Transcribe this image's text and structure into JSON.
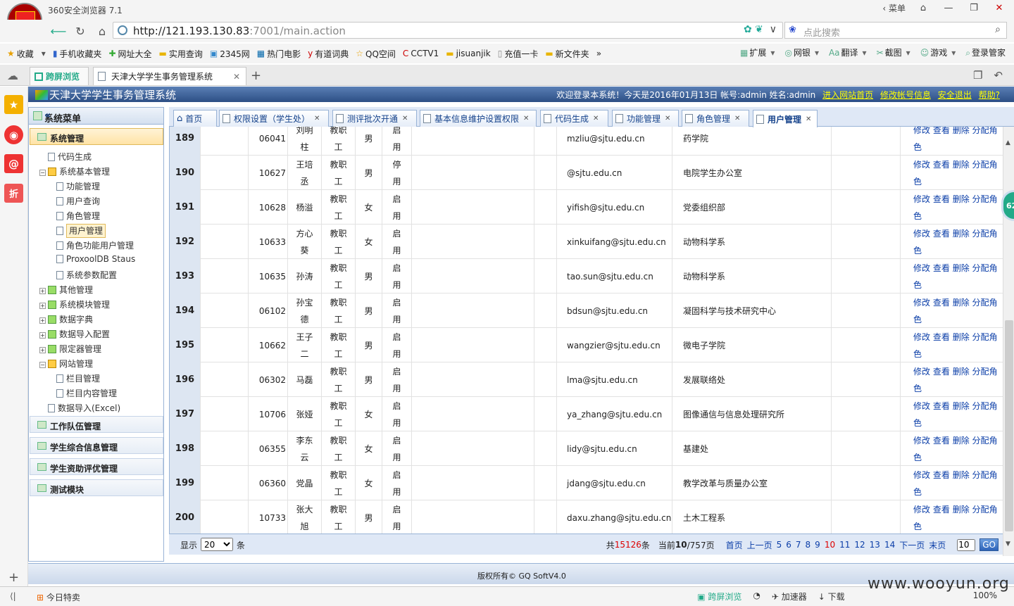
{
  "browser": {
    "title": "360安全浏览器 7.1",
    "menu_label": "菜单",
    "url_host": "http://121.193.130.83",
    "url_rest": ":7001/main.action",
    "search_placeholder": "点此搜索",
    "bookmarks": [
      "收藏",
      "手机收藏夹",
      "网址大全",
      "实用查询",
      "2345网",
      "热门电影",
      "有道词典",
      "QQ空间",
      "CCTV1",
      "jisuanjik",
      "充值一卡",
      "新文件夹",
      "»"
    ],
    "bookmark_tools": [
      "扩展",
      "网银",
      "翻译",
      "截图",
      "游戏",
      "登录管家"
    ],
    "tabs": [
      {
        "label": "跨屏浏览"
      },
      {
        "label": "天津大学学生事务管理系统"
      }
    ],
    "status_left": "今日特卖",
    "status_right": [
      "跨屏浏览",
      "加速器",
      "下载",
      "100%"
    ],
    "watermark": "www.wooyun.org"
  },
  "app": {
    "system_name": "天津大学学生事务管理系统",
    "welcome": "欢迎登录本系统！今天是2016年01月13日  帐号:admin 姓名:admin",
    "links": [
      "进入网站首页",
      "修改帐号信息",
      "安全退出",
      "帮助?"
    ],
    "footer": "版权所有© GQ SoftV4.0"
  },
  "menu": {
    "title": "系统菜单",
    "groups_top": [
      "系统管理"
    ],
    "tree": [
      {
        "label": "代码生成",
        "level": 1,
        "kind": "doc"
      },
      {
        "label": "系统基本管理",
        "level": 1,
        "kind": "folder-open"
      },
      {
        "label": "功能管理",
        "level": 2,
        "kind": "doc"
      },
      {
        "label": "用户查询",
        "level": 2,
        "kind": "doc"
      },
      {
        "label": "角色管理",
        "level": 2,
        "kind": "doc"
      },
      {
        "label": "用户管理",
        "level": 2,
        "kind": "doc",
        "selected": true
      },
      {
        "label": "角色功能用户管理",
        "level": 2,
        "kind": "doc"
      },
      {
        "label": "ProxoolDB Staus",
        "level": 2,
        "kind": "doc"
      },
      {
        "label": "系统参数配置",
        "level": 2,
        "kind": "doc"
      },
      {
        "label": "其他管理",
        "level": 1,
        "kind": "folder"
      },
      {
        "label": "系统模块管理",
        "level": 1,
        "kind": "folder"
      },
      {
        "label": "数据字典",
        "level": 1,
        "kind": "folder"
      },
      {
        "label": "数据导入配置",
        "level": 1,
        "kind": "folder"
      },
      {
        "label": "限定器管理",
        "level": 1,
        "kind": "folder"
      },
      {
        "label": "网站管理",
        "level": 1,
        "kind": "folder-open"
      },
      {
        "label": "栏目管理",
        "level": 2,
        "kind": "doc"
      },
      {
        "label": "栏目内容管理",
        "level": 2,
        "kind": "doc"
      },
      {
        "label": "数据导入(Excel)",
        "level": 1,
        "kind": "doc"
      }
    ],
    "groups_bottom": [
      "工作队伍管理",
      "学生综合信息管理",
      "学生资助评优管理",
      "测试模块"
    ]
  },
  "content_tabs": [
    "首页",
    "权限设置（学生处）",
    "测评批次开通",
    "基本信息维护设置权限",
    "代码生成",
    "功能管理",
    "角色管理",
    "用户管理"
  ],
  "grid": {
    "ops": [
      "修改",
      "查看",
      "删除",
      "分配角",
      "色"
    ],
    "rows": [
      {
        "n": "189",
        "code": "06041",
        "name": [
          "刘明",
          "柱"
        ],
        "type": [
          "教职",
          "工"
        ],
        "sex": "男",
        "status": [
          "启",
          "用"
        ],
        "email": "mzliu@sjtu.edu.cn",
        "dept": "药学院"
      },
      {
        "n": "190",
        "code": "10627",
        "name": [
          "王培",
          "丞"
        ],
        "type": [
          "教职",
          "工"
        ],
        "sex": "男",
        "status": [
          "停",
          "用"
        ],
        "email": "@sjtu.edu.cn",
        "dept": "电院学生办公室"
      },
      {
        "n": "191",
        "code": "10628",
        "name": [
          "杨溢"
        ],
        "type": [
          "教职",
          "工"
        ],
        "sex": "女",
        "status": [
          "启",
          "用"
        ],
        "email": "yifish@sjtu.edu.cn",
        "dept": "党委组织部"
      },
      {
        "n": "192",
        "code": "10633",
        "name": [
          "方心",
          "葵"
        ],
        "type": [
          "教职",
          "工"
        ],
        "sex": "女",
        "status": [
          "启",
          "用"
        ],
        "email": "xinkuifang@sjtu.edu.cn",
        "dept": "动物科学系"
      },
      {
        "n": "193",
        "code": "10635",
        "name": [
          "孙涛"
        ],
        "type": [
          "教职",
          "工"
        ],
        "sex": "男",
        "status": [
          "启",
          "用"
        ],
        "email": "tao.sun@sjtu.edu.cn",
        "dept": "动物科学系"
      },
      {
        "n": "194",
        "code": "06102",
        "name": [
          "孙宝",
          "德"
        ],
        "type": [
          "教职",
          "工"
        ],
        "sex": "男",
        "status": [
          "启",
          "用"
        ],
        "email": "bdsun@sjtu.edu.cn",
        "dept": "凝固科学与技术研究中心"
      },
      {
        "n": "195",
        "code": "10662",
        "name": [
          "王子",
          "二"
        ],
        "type": [
          "教职",
          "工"
        ],
        "sex": "男",
        "status": [
          "启",
          "用"
        ],
        "email": "wangzier@sjtu.edu.cn",
        "dept": "微电子学院"
      },
      {
        "n": "196",
        "code": "06302",
        "name": [
          "马磊"
        ],
        "type": [
          "教职",
          "工"
        ],
        "sex": "男",
        "status": [
          "启",
          "用"
        ],
        "email": "lma@sjtu.edu.cn",
        "dept": "发展联络处"
      },
      {
        "n": "197",
        "code": "10706",
        "name": [
          "张娅"
        ],
        "type": [
          "教职",
          "工"
        ],
        "sex": "女",
        "status": [
          "启",
          "用"
        ],
        "email": "ya_zhang@sjtu.edu.cn",
        "dept": "图像通信与信息处理研究所"
      },
      {
        "n": "198",
        "code": "06355",
        "name": [
          "李东",
          "云"
        ],
        "type": [
          "教职",
          "工"
        ],
        "sex": "女",
        "status": [
          "启",
          "用"
        ],
        "email": "lidy@sjtu.edu.cn",
        "dept": "基建处"
      },
      {
        "n": "199",
        "code": "06360",
        "name": [
          "党晶"
        ],
        "type": [
          "教职",
          "工"
        ],
        "sex": "女",
        "status": [
          "启",
          "用"
        ],
        "email": "jdang@sjtu.edu.cn",
        "dept": "教学改革与质量办公室"
      },
      {
        "n": "200",
        "code": "10733",
        "name": [
          "张大",
          "旭"
        ],
        "type": [
          "教职",
          "工"
        ],
        "sex": "男",
        "status": [
          "启",
          "用"
        ],
        "email": "daxu.zhang@sjtu.edu.cn",
        "dept": "土木工程系"
      }
    ]
  },
  "pager": {
    "show_label": "显示",
    "page_size": "20",
    "unit": "条",
    "total_prefix": "共",
    "total": "15126",
    "total_suffix": "条",
    "current_prefix": "当前",
    "current": "10",
    "current_total": "/757页",
    "first": "首页",
    "prev": "上一页",
    "pages": [
      "5",
      "6",
      "7",
      "8",
      "9",
      "10",
      "11",
      "12",
      "13",
      "14"
    ],
    "current_page": "10",
    "next": "下一页",
    "last": "末页",
    "goto_value": "10",
    "go": "GO"
  },
  "side_circle": "62"
}
